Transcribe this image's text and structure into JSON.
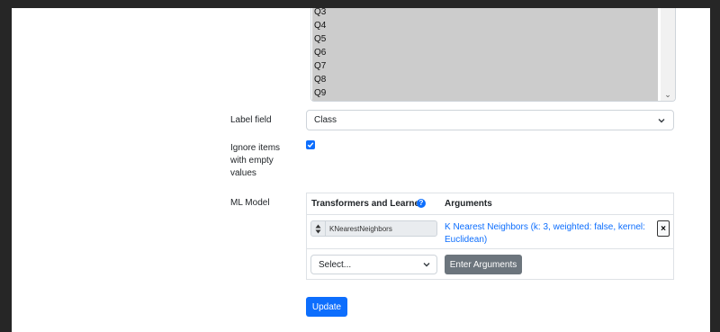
{
  "feature_list": {
    "options": [
      "Q3",
      "Q4",
      "Q5",
      "Q6",
      "Q7",
      "Q8",
      "Q9"
    ]
  },
  "label_field": {
    "label": "Label field",
    "selected": "Class"
  },
  "ignore_empty": {
    "label_lines": [
      "Ignore items",
      "with empty",
      "values"
    ],
    "checked": true
  },
  "ml_model": {
    "label": "ML Model",
    "header_transformers": "Transformers and Learner",
    "header_arguments": "Arguments",
    "help_icon": "?",
    "rows": [
      {
        "transformer": "KNearestNeighbors",
        "arguments": "K Nearest Neighbors (k: 3, weighted: false, kernel: Euclidean)",
        "remove_label": "×"
      }
    ],
    "new_select": "Select...",
    "enter_arguments_label": "Enter Arguments"
  },
  "update_label": "Update",
  "colors": {
    "primary": "#0d6efd",
    "secondary": "#6c757d",
    "selected_option_bg": "#cccccc"
  }
}
